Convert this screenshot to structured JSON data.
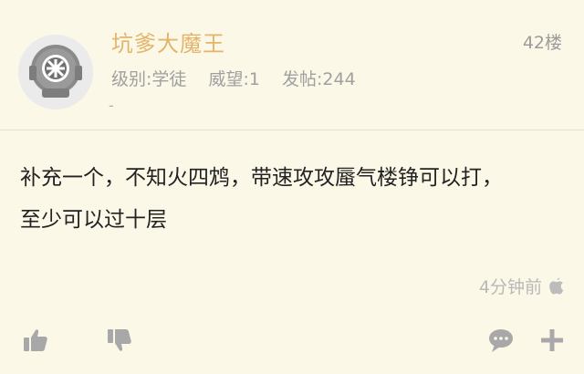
{
  "post": {
    "username": "坑爹大魔王",
    "floor": "42楼",
    "level": "级别:学徒",
    "prestige": "威望:1",
    "posts": "发帖:244",
    "signature": "-",
    "content_line1": "补充一个，不知火四鸩，带速攻攻蜃气楼铮可以打，",
    "content_line2": "至少可以过十层",
    "time": "4分钟前",
    "device_icon": "apple-icon"
  },
  "icons": {
    "like": "thumbs-up-icon",
    "dislike": "thumbs-down-icon",
    "comment": "comment-icon",
    "more": "plus-icon"
  },
  "colors": {
    "background": "#fcf8e8",
    "username": "#e3b46a",
    "meta": "#a0a0a0",
    "icon": "#a9a9a9"
  }
}
